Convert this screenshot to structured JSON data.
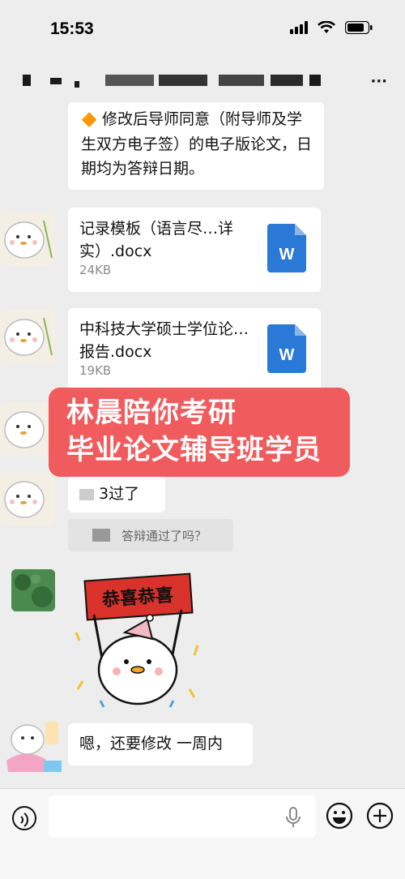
{
  "status": {
    "time": "15:53"
  },
  "messages": {
    "m1_text": "修改后导师同意（附导师及学生双方电子签）的电子版论文，日期均为答辩日期。",
    "m1_emoji": "🔶",
    "file1": {
      "name": "记录模板（语言尽…详实）.docx",
      "size": "24KB",
      "icon_label": "W"
    },
    "file2": {
      "name": "中科技大学硕士学位论…报告.docx",
      "size": "19KB",
      "icon_label": "W"
    },
    "m4_text": "3过了",
    "quote_text": "答辩通过了吗？",
    "sticker_banner": "恭喜恭喜",
    "m6_text": "嗯，还要修改 一周内"
  },
  "watermark": {
    "line1": "林晨陪你考研",
    "line2": "毕业论文辅导班学员"
  },
  "colors": {
    "background": "#ededed",
    "bubble": "#ffffff",
    "watermark": "#f05052",
    "word_icon": "#2a79d6",
    "sticker_banner": "#d9322b"
  },
  "icons": [
    "signal-icon",
    "wifi-icon",
    "battery-icon",
    "more-icon",
    "voice-icon",
    "mic-icon",
    "emoji-icon",
    "plus-icon",
    "word-file-icon"
  ]
}
